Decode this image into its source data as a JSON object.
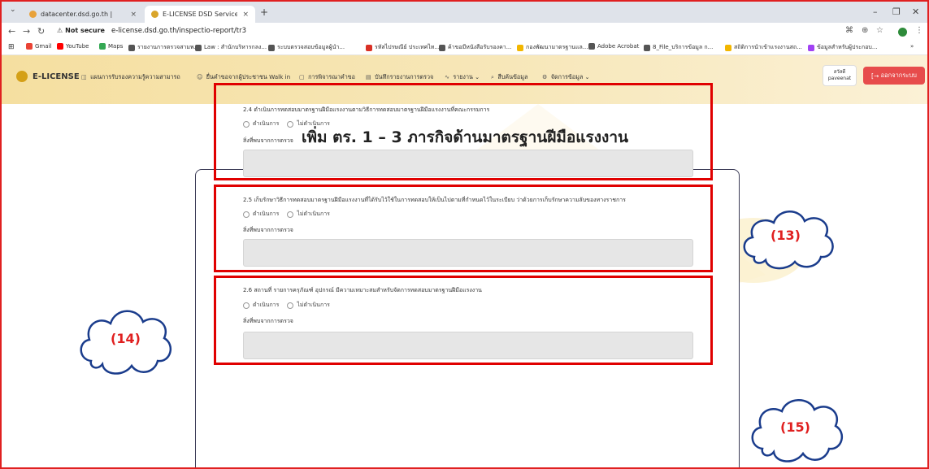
{
  "browser": {
    "tabs": [
      {
        "title": "datacenter.dsd.go.th |",
        "close": "×"
      },
      {
        "title": "E-LICENSE DSD Service - ระบบบ",
        "close": "×"
      }
    ],
    "new_tab": "+",
    "address": {
      "security": "Not secure",
      "url": "e-license.dsd.go.th/inspectio-report/tr3"
    },
    "bookmarks": [
      {
        "label": "Gmail",
        "color": "#ea4335"
      },
      {
        "label": "YouTube",
        "color": "#ff0000"
      },
      {
        "label": "Maps",
        "color": "#34a853"
      },
      {
        "label": "รายงานการตรวจสามพ...",
        "color": "#555555"
      },
      {
        "label": "Law : สำนักบริหารกลง...",
        "color": "#555555"
      },
      {
        "label": "ระบบตรวจสอบข้อมูลผู้นำ...",
        "color": "#555555"
      },
      {
        "label": "รหัสไปรษณีย์ ประเทศไท...",
        "color": "#d93025"
      },
      {
        "label": "ค้าขอมีหนังสือรับรองคา...",
        "color": "#555555"
      },
      {
        "label": "กองพัฒนามาตรฐานแล...",
        "color": "#f2b600"
      },
      {
        "label": "Adobe Acrobat",
        "color": "#555555"
      },
      {
        "label": "8_File_บริการข้อมูล ก...",
        "color": "#555555"
      },
      {
        "label": "สถิติการนำเข้าแรงงานสถ...",
        "color": "#f2b600"
      },
      {
        "label": "ข้อมูลสำหรับผู้ประกอบ...",
        "color": "#a142f4"
      }
    ]
  },
  "app": {
    "brand": "E-LICENSE",
    "menu": [
      {
        "label": "แผนการรับรองความรู้ความสามารถ"
      },
      {
        "label": "ยื่นคำขอจากผู้ประชาชน Walk in"
      },
      {
        "label": "การพิจารณาคำขอ"
      },
      {
        "label": "บันทึกรายงานการตรวจ"
      },
      {
        "label": "รายงาน ⌄"
      },
      {
        "label": "สืบค้นข้อมูล"
      },
      {
        "label": "จัดการข้อมูล ⌄"
      }
    ],
    "user": {
      "name": "สวัสดี",
      "username": "paveenat"
    },
    "logout": "ออกจากระบบ"
  },
  "page": {
    "title": "เพิ่ม ตร. 1 – 3 ภารกิจด้านมาตรฐานฝีมือแรงงาน",
    "sections": [
      {
        "question": "2.4 ดำเนินการทดสอบมาตรฐานฝีมือแรงงานตามวิธีการทดสอบมาตรฐานฝีมือแรงงานที่คณะกรรมการ",
        "options": [
          "ดำเนินการ",
          "ไม่ดำเนินการ"
        ],
        "findings_label": "สิ่งที่พบจากการตรวจ",
        "findings_value": "",
        "callout": "(13)"
      },
      {
        "question": "2.5 เก็บรักษาวิธีการทดสอบมาตรฐานฝีมือแรงงานที่ได้รับไว้ใช้ในการทดสอบให้เป็นไปตามที่กำหนดไว้ในระเบียบ ว่าด้วยการเก็บรักษาความลับของทางราชการ",
        "options": [
          "ดำเนินการ",
          "ไม่ดำเนินการ"
        ],
        "findings_label": "สิ่งที่พบจากการตรวจ",
        "findings_value": "",
        "callout": "(14)"
      },
      {
        "question": "2.6 สถานที่ รายการครุภัณฑ์ อุปกรณ์ มีความเหมาะสมสำหรับจัดการทดสอบมาตรฐานฝีมือแรงงาน",
        "options": [
          "ดำเนินการ",
          "ไม่ดำเนินการ"
        ],
        "findings_label": "สิ่งที่พบจากการตรวจ",
        "findings_value": "",
        "callout": "(15)"
      }
    ]
  },
  "colors": {
    "annotation_red": "#e00000",
    "logout_red": "#e74c4c",
    "header_gold": "#f5dfa0"
  }
}
